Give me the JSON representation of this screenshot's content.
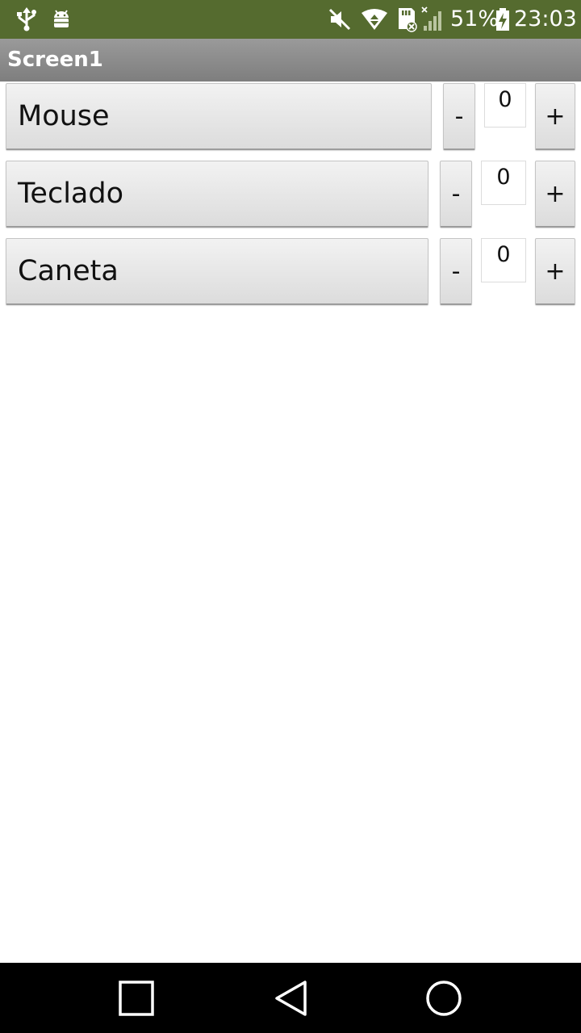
{
  "status_bar": {
    "battery": "51%",
    "time": "23:03",
    "icons": [
      "usb-icon",
      "android-debug-icon",
      "mute-icon",
      "wifi-icon",
      "sd-card-icon",
      "signal-icon",
      "battery-charging-icon"
    ]
  },
  "app": {
    "title": "Screen1"
  },
  "items": [
    {
      "label": "Mouse",
      "minus": "-",
      "count": "0",
      "plus": "+"
    },
    {
      "label": "Teclado",
      "minus": "-",
      "count": "0",
      "plus": "+"
    },
    {
      "label": "Caneta",
      "minus": "-",
      "count": "0",
      "plus": "+"
    }
  ],
  "nav_bar": {
    "icons": [
      "recents-icon",
      "back-icon",
      "home-icon"
    ]
  },
  "colors": {
    "status_bar": "#556b2f",
    "title_bar": "#8c8c8c",
    "background": "#ffffff"
  }
}
